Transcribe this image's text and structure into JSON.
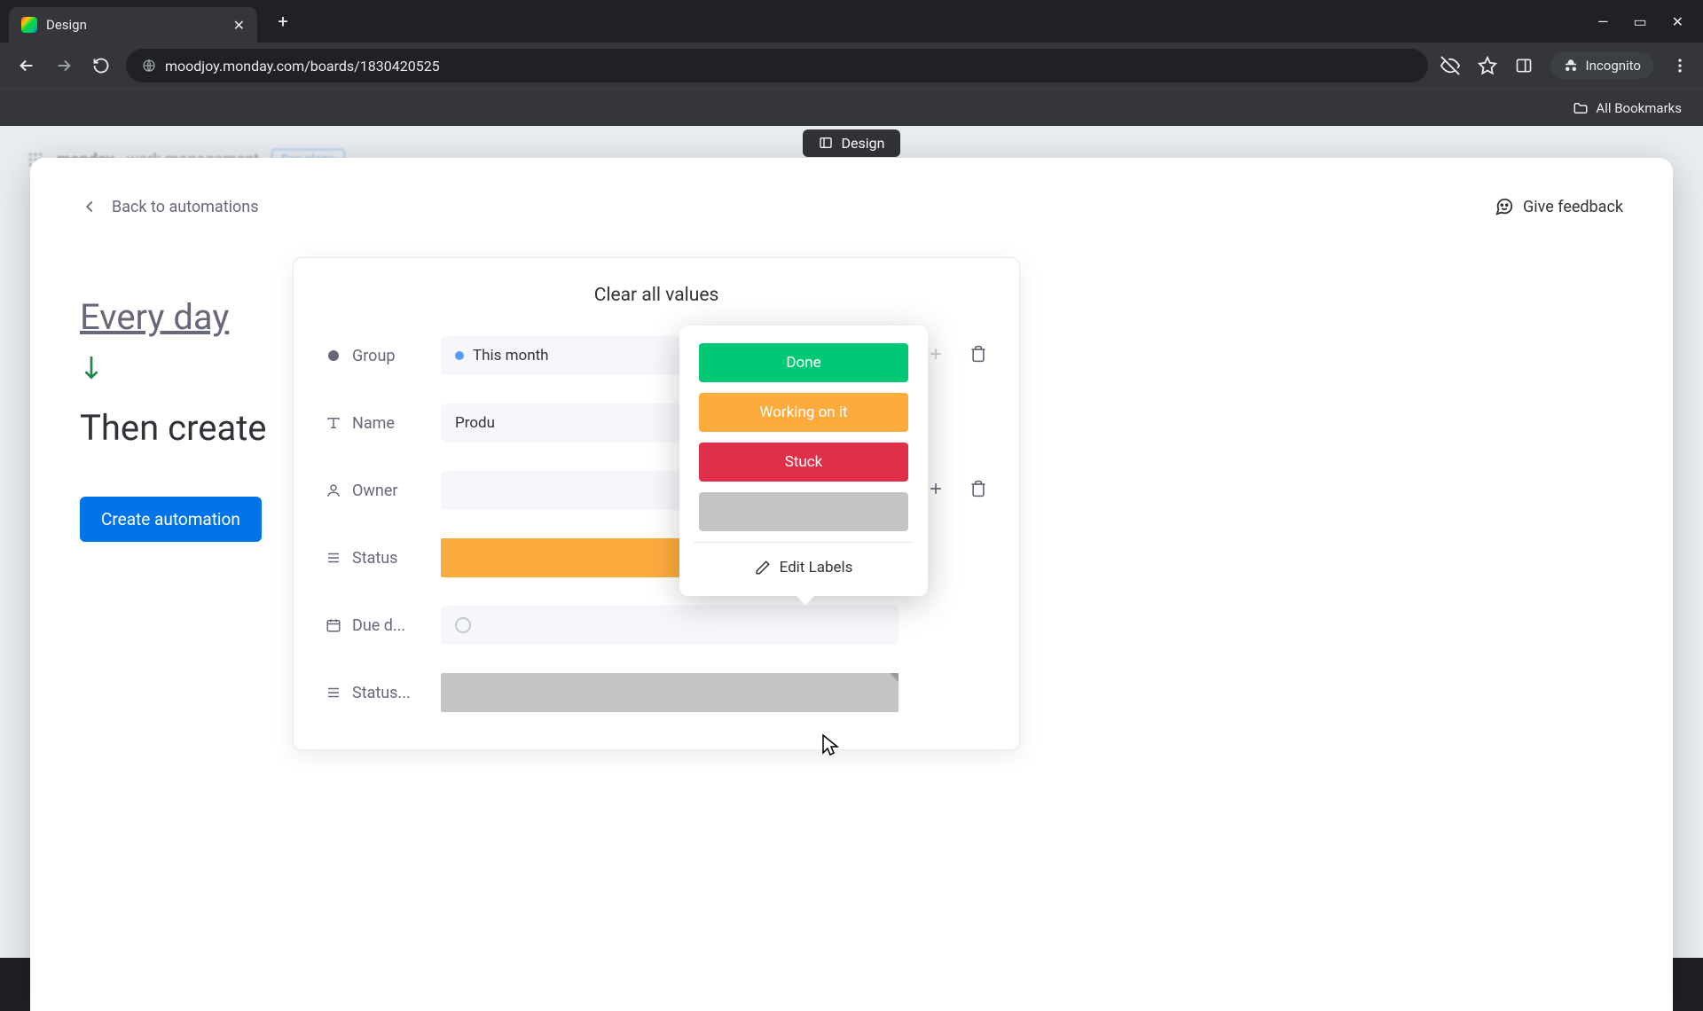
{
  "browser": {
    "tab_title": "Design",
    "url": "moodjoy.monday.com/boards/1830420525",
    "incognito_label": "Incognito",
    "all_bookmarks": "All Bookmarks"
  },
  "page_pill": "Design",
  "blurred_app": {
    "brand": "monday",
    "suffix": "work management",
    "chip": "See plans"
  },
  "modal": {
    "back": "Back to automations",
    "feedback": "Give feedback",
    "trigger": "Every day",
    "then": "Then create",
    "create_button": "Create automation"
  },
  "panel": {
    "clear": "Clear all values",
    "rows": {
      "group": {
        "label": "Group",
        "value": "This month"
      },
      "name": {
        "label": "Name",
        "value": "Produ"
      },
      "owner": {
        "label": "Owner"
      },
      "status": {
        "label": "Status"
      },
      "due": {
        "label": "Due d..."
      },
      "status2": {
        "label": "Status..."
      }
    }
  },
  "dropdown": {
    "options": {
      "done": "Done",
      "working": "Working on it",
      "stuck": "Stuck"
    },
    "edit": "Edit Labels"
  },
  "colors": {
    "done": "#00c875",
    "working": "#fdab3d",
    "stuck": "#df2f4a",
    "primary": "#0073ea"
  }
}
